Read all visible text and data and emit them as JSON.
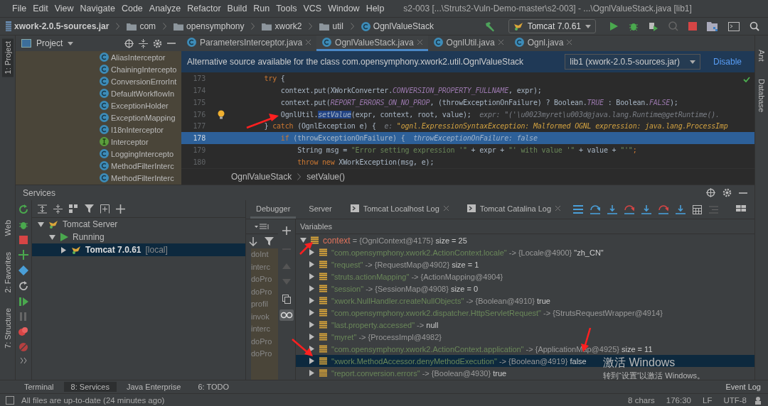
{
  "window": {
    "title": "s2-003 [...\\Struts2-Vuln-Demo-master\\s2-003] - ...\\OgnlValueStack.java [lib1]"
  },
  "menu": [
    "File",
    "Edit",
    "View",
    "Navigate",
    "Code",
    "Analyze",
    "Refactor",
    "Build",
    "Run",
    "Tools",
    "VCS",
    "Window",
    "Help"
  ],
  "breadcrumbs": [
    {
      "label": "xwork-2.0.5-sources.jar",
      "kind": "jar"
    },
    {
      "label": "com",
      "kind": "folder"
    },
    {
      "label": "opensymphony",
      "kind": "folder"
    },
    {
      "label": "xwork2",
      "kind": "folder"
    },
    {
      "label": "util",
      "kind": "folder"
    },
    {
      "label": "OgnlValueStack",
      "kind": "class"
    }
  ],
  "run_config": "Tomcat 7.0.61",
  "left_stripe": {
    "top": [
      {
        "label": "1: Project",
        "selected": true
      }
    ],
    "bottom": [
      {
        "label": "Web",
        "selected": false
      },
      {
        "label": "2: Favorites",
        "selected": false
      },
      {
        "label": "7: Structure",
        "selected": false
      }
    ]
  },
  "right_stripe": [
    {
      "label": "Ant",
      "selected": false
    },
    {
      "label": "Database",
      "selected": false
    }
  ],
  "project": {
    "title": "Project",
    "items": [
      {
        "label": "AliasInterceptor",
        "kind": "class"
      },
      {
        "label": "ChainingIntercepto",
        "kind": "class"
      },
      {
        "label": "ConversionErrorInt",
        "kind": "class"
      },
      {
        "label": "DefaultWorkflowIn",
        "kind": "class"
      },
      {
        "label": "ExceptionHolder",
        "kind": "class"
      },
      {
        "label": "ExceptionMapping",
        "kind": "class"
      },
      {
        "label": "I18nInterceptor",
        "kind": "class"
      },
      {
        "label": "Interceptor",
        "kind": "interface"
      },
      {
        "label": "LoggingIntercepto",
        "kind": "class"
      },
      {
        "label": "MethodFilterInterc",
        "kind": "class"
      },
      {
        "label": "MethodFilterInterc",
        "kind": "class"
      }
    ]
  },
  "editor": {
    "tabs": [
      {
        "label": "ParametersInterceptor.java",
        "selected": false
      },
      {
        "label": "OgnlValueStack.java",
        "selected": true
      },
      {
        "label": "OgnlUtil.java",
        "selected": false
      },
      {
        "label": "Ognl.java",
        "selected": false
      }
    ],
    "banner": {
      "text": "Alternative source available for the class com.opensymphony.xwork2.util.OgnlValueStack",
      "select": "lib1 (xwork-2.0.5-sources.jar)",
      "link": "Disable"
    },
    "lines": [
      {
        "number": "173",
        "selected": false,
        "bulb": false,
        "segments": [
          {
            "kind": "kw",
            "text": "        try"
          },
          {
            "kind": "plain",
            "text": " {"
          }
        ]
      },
      {
        "number": "174",
        "selected": false,
        "bulb": false,
        "segments": [
          {
            "kind": "plain",
            "text": "            context.put(XWorkConverter."
          },
          {
            "kind": "const",
            "text": "CONVERSION_PROPERTY_FULLNAME"
          },
          {
            "kind": "plain",
            "text": ", expr);"
          }
        ]
      },
      {
        "number": "175",
        "selected": false,
        "bulb": false,
        "segments": [
          {
            "kind": "plain",
            "text": "            context.put("
          },
          {
            "kind": "const",
            "text": "REPORT_ERRORS_ON_NO_PROP"
          },
          {
            "kind": "plain",
            "text": ", (throwExceptionOnFailure) ? Boolean."
          },
          {
            "kind": "const",
            "text": "TRUE"
          },
          {
            "kind": "plain",
            "text": " : Boolean."
          },
          {
            "kind": "const",
            "text": "FALSE"
          },
          {
            "kind": "plain",
            "text": ");"
          }
        ]
      },
      {
        "number": "176",
        "selected": false,
        "bulb": true,
        "segments": [
          {
            "kind": "plain",
            "text": "            OgnlUtil."
          },
          {
            "kind": "sel",
            "text": "setValue"
          },
          {
            "kind": "plain",
            "text": "(expr, context, root, value);"
          },
          {
            "kind": "hint",
            "text": "  expr: \"('\\u0023myret\\u003d@java.lang.Runtime@getRuntime()."
          }
        ]
      },
      {
        "number": "177",
        "selected": false,
        "bulb": false,
        "segments": [
          {
            "kind": "plain",
            "text": "        } "
          },
          {
            "kind": "kw",
            "text": "catch"
          },
          {
            "kind": "plain",
            "text": " (OgnlException e) {"
          },
          {
            "kind": "hint",
            "text": "  e: "
          },
          {
            "kind": "inline",
            "text": "\"ognl.ExpressionSyntaxException: Malformed OGNL expression: java.lang.ProcessImp"
          }
        ]
      },
      {
        "number": "178",
        "selected": true,
        "bulb": false,
        "segments": [
          {
            "kind": "kw",
            "text": "            if"
          },
          {
            "kind": "plain",
            "text": " (throwExceptionOnFailure) {"
          },
          {
            "kind": "hint",
            "text": "  throwExceptionOnFailure: false"
          }
        ]
      },
      {
        "number": "179",
        "selected": false,
        "bulb": false,
        "segments": [
          {
            "kind": "plain",
            "text": "                String msg = "
          },
          {
            "kind": "str",
            "text": "\"Error setting expression '\""
          },
          {
            "kind": "plain",
            "text": " + expr + "
          },
          {
            "kind": "str",
            "text": "\"' with value '\""
          },
          {
            "kind": "plain",
            "text": " + value + "
          },
          {
            "kind": "str",
            "text": "\"'\""
          },
          {
            "kind": "kw",
            "text": ";"
          }
        ]
      },
      {
        "number": "180",
        "selected": false,
        "bulb": false,
        "segments": [
          {
            "kind": "kw",
            "text": "                throw new"
          },
          {
            "kind": "plain",
            "text": " XWorkException(msg, e);"
          }
        ]
      }
    ],
    "breadcrumbs": [
      "OgnlValueStack",
      "setValue()"
    ]
  },
  "services": {
    "title": "Services",
    "tree": [
      {
        "label": "Tomcat Server",
        "kind": "server",
        "expanded": true,
        "selected": false,
        "children": [
          {
            "label": "Running",
            "kind": "status",
            "expanded": true,
            "selected": false,
            "children": [
              {
                "label": "Tomcat 7.0.61",
                "suffix": "[local]",
                "kind": "server",
                "expanded": false,
                "selected": true
              }
            ]
          }
        ]
      }
    ],
    "debug_tabs": [
      {
        "label": "Debugger",
        "selected": true,
        "kind": "plain"
      },
      {
        "label": "Server",
        "selected": false,
        "kind": "plain"
      },
      {
        "label": "Tomcat Localhost Log",
        "selected": false,
        "kind": "log"
      },
      {
        "label": "Tomcat Catalina Log",
        "selected": false,
        "kind": "log"
      }
    ],
    "frames": [
      "doInt",
      "interc",
      "doPro",
      "doPro",
      "profil",
      "invok",
      "interc",
      "doPro",
      "doPro"
    ],
    "variables_title": "Variables",
    "variables": [
      {
        "name": "context",
        "value": "= {OgnlContext@4175}",
        "extra": "size = 25",
        "expanded": true,
        "selected": false,
        "children": [
          {
            "name": "\"com.opensymphony.xwork2.ActionContext.locale\"",
            "value": "-> {Locale@4900}",
            "extra": "\"zh_CN\"",
            "expanded": false,
            "selected": false
          },
          {
            "name": "\"request\"",
            "value": "-> {RequestMap@4902}",
            "extra": "size = 1",
            "expanded": false,
            "selected": false
          },
          {
            "name": "\"struts.actionMapping\"",
            "value": "-> {ActionMapping@4904}",
            "expanded": false,
            "selected": false
          },
          {
            "name": "\"session\"",
            "value": "-> {SessionMap@4908}",
            "extra": "size = 0",
            "expanded": false,
            "selected": false
          },
          {
            "name": "\"xwork.NullHandler.createNullObjects\"",
            "value": "-> {Boolean@4910}",
            "extra": "true",
            "expanded": false,
            "selected": false
          },
          {
            "name": "\"com.opensymphony.xwork2.dispatcher.HttpServletRequest\"",
            "value": "-> {StrutsRequestWrapper@4914}",
            "expanded": false,
            "selected": false
          },
          {
            "name": "\"last.property.accessed\"",
            "value": "->",
            "extra": "null",
            "expanded": false,
            "selected": false
          },
          {
            "name": "\"myret\"",
            "value": "-> {ProcessImpl@4982}",
            "expanded": false,
            "selected": false
          },
          {
            "name": "\"com.opensymphony.xwork2.ActionContext.application\"",
            "value": "-> {ApplicationMap@4925}",
            "extra": "size = 11",
            "expanded": false,
            "selected": false
          },
          {
            "name": "\"xwork.MethodAccessor.denyMethodExecution\"",
            "value": "-> {Boolean@4919}",
            "extra": "false",
            "expanded": false,
            "selected": true
          },
          {
            "name": "\"report.conversion.errors\"",
            "value": "-> {Boolean@4930}",
            "extra": "true",
            "expanded": false,
            "selected": false
          }
        ]
      }
    ]
  },
  "activation": {
    "title": "激活 Windows",
    "text": "转到“设置”以激活 Windows。"
  },
  "event_log": "Event Log",
  "tool_tabs": [
    {
      "label": "Terminal",
      "selected": false
    },
    {
      "label": "8: Services",
      "selected": true
    },
    {
      "label": "Java Enterprise",
      "selected": false
    },
    {
      "label": "6: TODO",
      "selected": false
    }
  ],
  "status_bar": {
    "message": "All files are up-to-date (24 minutes ago)",
    "items": [
      "8 chars",
      "176:30",
      "LF",
      "UTF-8"
    ]
  }
}
